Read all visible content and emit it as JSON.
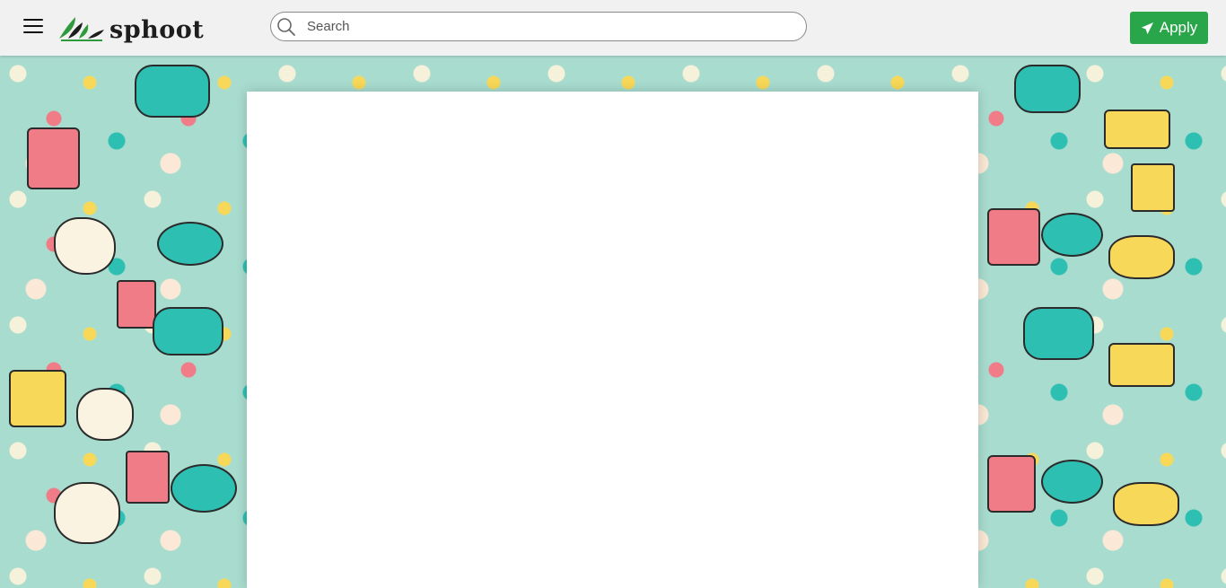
{
  "header": {
    "logo_text": "sphoot",
    "search": {
      "placeholder": "Search",
      "value": ""
    },
    "apply_label": "Apply",
    "icons": {
      "menu": "hamburger-menu-icon",
      "logo": "leaf-logo-icon",
      "search": "search-icon",
      "apply": "paper-plane-icon"
    }
  },
  "colors": {
    "header_bg": "#f1f1f1",
    "apply_button": "#2aa64a",
    "pattern_bg": "#a8dccf",
    "panel_bg": "#ffffff"
  }
}
